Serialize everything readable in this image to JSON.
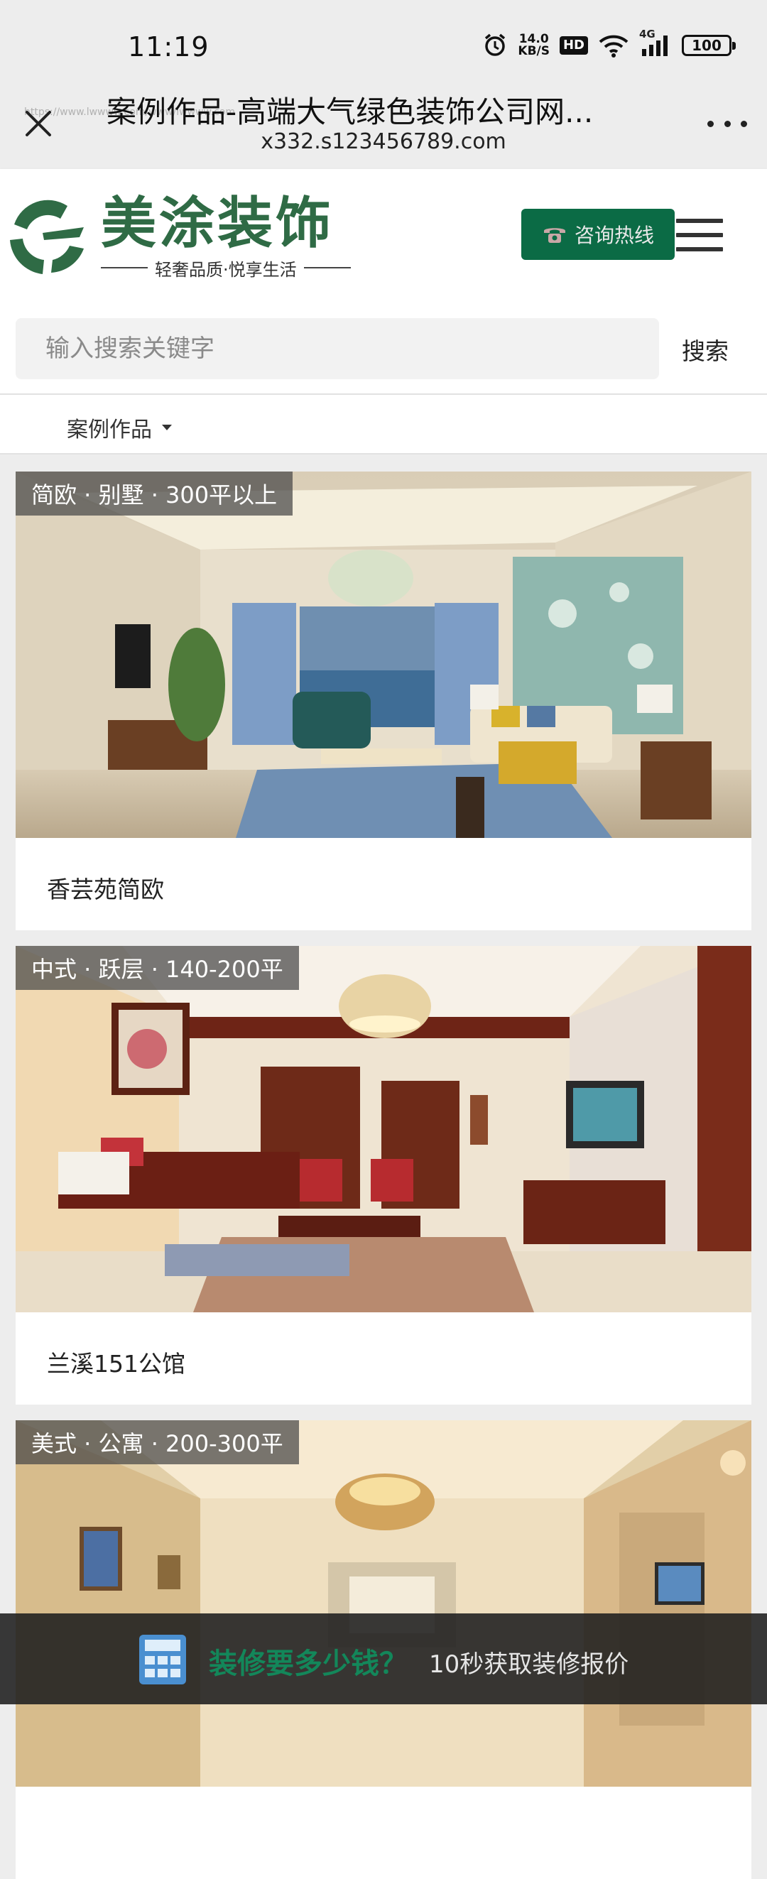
{
  "status_bar": {
    "time": "11:19",
    "net_speed_value": "14.0",
    "net_speed_unit": "KB/S",
    "hd_label": "HD",
    "network_label": "4G",
    "battery": "100"
  },
  "browser": {
    "title": "案例作品-高端大气绿色装饰公司网...",
    "url": "x332.s123456789.com",
    "ghost_url": "https://www.lwwww.com/www/lwwww.com"
  },
  "header": {
    "logo_name": "美涂装饰",
    "logo_slogan": "轻奢品质·悦享生活",
    "hotline_label": "咨询热线",
    "brand_color": "#0b6b45"
  },
  "search": {
    "placeholder": "输入搜索关键字",
    "button_label": "搜索"
  },
  "filter": {
    "selected": "案例作品"
  },
  "cases": [
    {
      "tag": "简欧 · 别墅 · 300平以上",
      "name": "香芸苑简欧"
    },
    {
      "tag": "中式 · 跃层 · 140-200平",
      "name": "兰溪151公馆"
    },
    {
      "tag": "美式 · 公寓 · 200-300平",
      "name": ""
    }
  ],
  "banner": {
    "title": "装修要多少钱？",
    "subtitle": "10秒获取装修报价"
  }
}
